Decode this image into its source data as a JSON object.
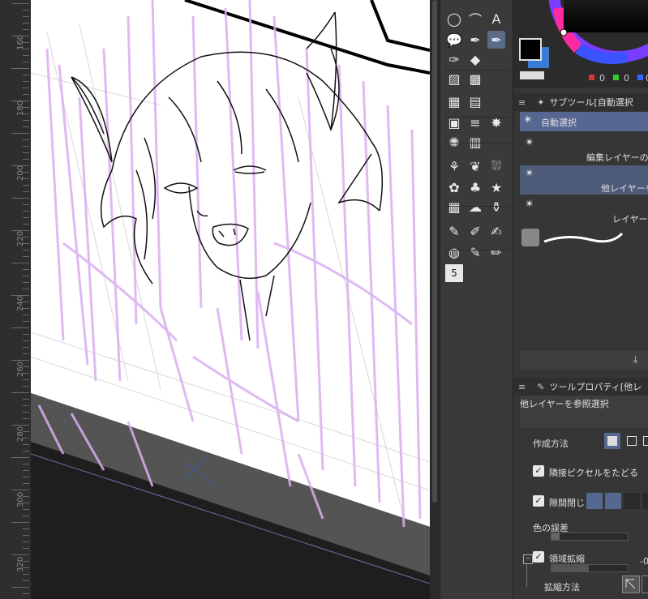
{
  "ruler": {
    "labels": [
      "160",
      "180",
      "200",
      "220",
      "240",
      "260",
      "280",
      "300",
      "320"
    ]
  },
  "toolbox": {
    "icons": [
      "ellipse-icon",
      "curve-icon",
      "text-icon",
      "speech-balloon-icon",
      "pen-icon",
      "pen-selected-icon",
      "nib-icon",
      "fill-diamond-icon",
      "stamp-icon",
      "screentone-icon",
      "hatch-icon",
      "hatch2-icon",
      "gradient-icon",
      "speedline-icon",
      "burst-icon",
      "radial-line-icon",
      "highlight-icon",
      "grass-icon",
      "leaf-icon",
      "rain-icon",
      "flower-icon",
      "tree-icon",
      "star-icon",
      "texture-icon",
      "sky-icon",
      "bottle-icon",
      "vector-pen-icon",
      "brush-icon",
      "pencil-stamp-icon",
      "bucket-icon",
      "fill-brush-icon",
      "eraser-icon",
      "letter-s-icon"
    ],
    "s_label": "5"
  },
  "color": {
    "main": "#000000",
    "sub": "#3a7bd5",
    "rgb_values": [
      "0",
      "0",
      "0"
    ]
  },
  "subtool_panel": {
    "title": "サブツール[自動選択",
    "items": [
      {
        "label": "自動選択"
      },
      {
        "label": "編集レイヤーのみ"
      },
      {
        "label": "他レイヤーを"
      },
      {
        "label": "レイヤー"
      }
    ]
  },
  "toolprop_panel": {
    "title": "ツールプロパティ[他レ",
    "subtitle": "他レイヤーを参照選択",
    "creation_method_label": "作成方法",
    "adjacent_pixels_label": "隣接ピクセルをたどる",
    "gap_close_label": "隙間閉じ",
    "color_tolerance_label": "色の誤差",
    "area_expand_label": "領域拡縮",
    "expand_method_label": "拡縮方法",
    "expand_value": "-0"
  },
  "colors": {
    "accent": "#5b6b8a",
    "selected_blue": "#566892",
    "sketch_purple": "#d6a8ee"
  }
}
